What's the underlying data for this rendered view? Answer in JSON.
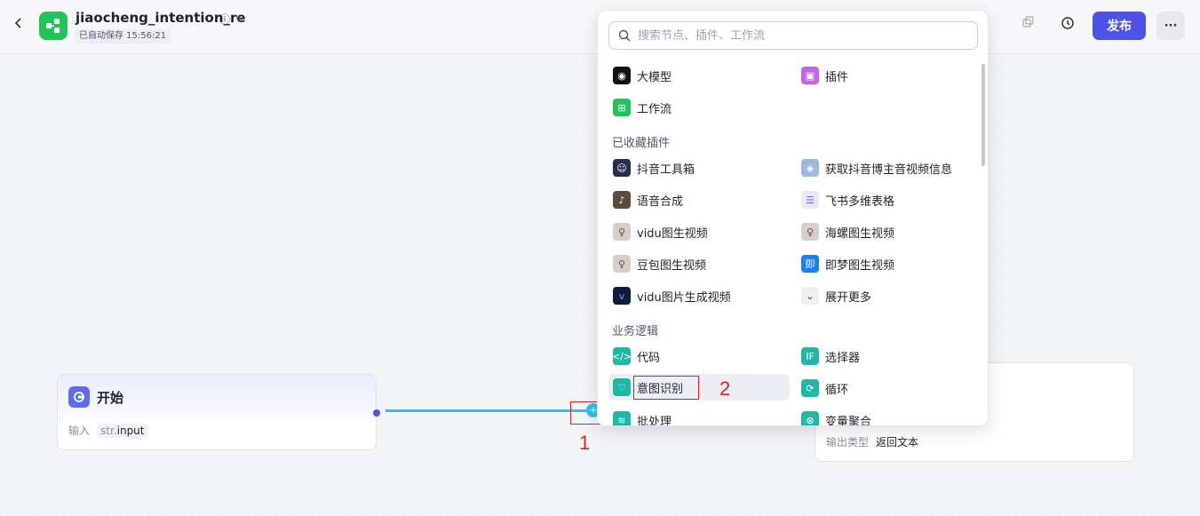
{
  "header": {
    "title": "jiaocheng_intention_re",
    "autosave": "已自动保存 15:56:21",
    "publish_label": "发布",
    "more_label": "···"
  },
  "start_node": {
    "title": "开始",
    "input_label": "输入",
    "param_type": "str.",
    "param_name": "input"
  },
  "end_node": {
    "output_type_label": "输出类型",
    "output_type_value": "返回文本"
  },
  "popup": {
    "search_placeholder": "搜索节点、插件、工作流",
    "top_items": [
      {
        "label": "大模型",
        "icon": "llm-icon"
      },
      {
        "label": "插件",
        "icon": "plugin-icon"
      },
      {
        "label": "工作流",
        "icon": "workflow-icon"
      }
    ],
    "section_favorites": "已收藏插件",
    "favorites": [
      {
        "label": "抖音工具箱"
      },
      {
        "label": "获取抖音博主音视频信息"
      },
      {
        "label": "语音合成"
      },
      {
        "label": "飞书多维表格"
      },
      {
        "label": "vidu图生视频"
      },
      {
        "label": "海螺图生视频"
      },
      {
        "label": "豆包图生视频"
      },
      {
        "label": "即梦图生视频"
      },
      {
        "label": "vidu图片生成视频"
      },
      {
        "label": "展开更多"
      }
    ],
    "section_logic": "业务逻辑",
    "logic": [
      {
        "label": "代码",
        "icon": "code-icon"
      },
      {
        "label": "选择器",
        "icon": "if-icon"
      },
      {
        "label": "意图识别",
        "icon": "intent-icon"
      },
      {
        "label": "循环",
        "icon": "loop-icon"
      },
      {
        "label": "批处理",
        "icon": "batch-icon"
      },
      {
        "label": "变量聚合",
        "icon": "aggregate-icon"
      }
    ]
  },
  "annotations": [
    "1",
    "2"
  ],
  "colors": {
    "accent": "#4d53e8",
    "edge": "#2ac1f1",
    "annotation": "#e02020",
    "logic_icon": "#1fb8a6"
  }
}
